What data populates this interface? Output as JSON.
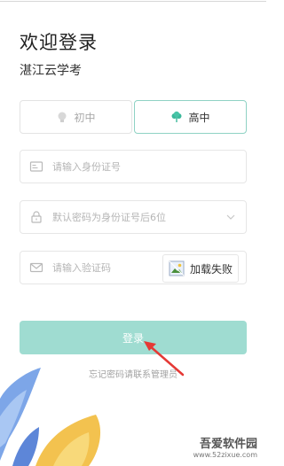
{
  "header": {
    "title": "欢迎登录",
    "app_name": "湛江云学考"
  },
  "grade_tabs": [
    {
      "label": "初中",
      "icon": "lightbulb-icon",
      "selected": false
    },
    {
      "label": "高中",
      "icon": "cloud-tree-icon",
      "selected": true
    }
  ],
  "form": {
    "id_field": {
      "placeholder": "请输入身份证号",
      "icon": "id-card-icon"
    },
    "password_field": {
      "placeholder": "默认密码为身份证号后6位",
      "icon": "lock-icon"
    },
    "code_field": {
      "placeholder": "请输入验证码",
      "icon": "envelope-icon"
    },
    "captcha": {
      "text": "加载失败",
      "icon": "broken-image-icon"
    }
  },
  "login_button": {
    "label": "登录"
  },
  "forgot_text": "忘记密码请联系管理员",
  "watermark": {
    "text": "吾爱软件园",
    "url": "www.52zixue.com"
  },
  "colors": {
    "accent": "#9fdcd1",
    "accent_border": "#8fd2c4",
    "placeholder": "#b5b5b5",
    "arrow": "#e53935"
  }
}
